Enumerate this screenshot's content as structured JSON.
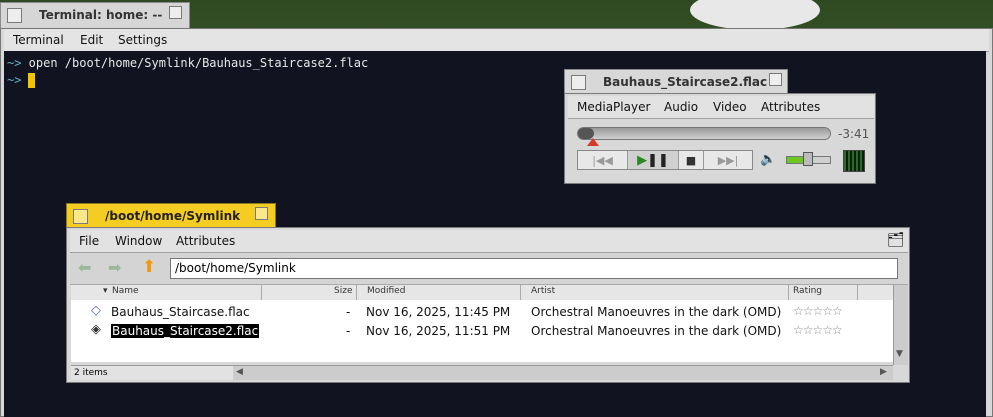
{
  "terminal": {
    "title": "Terminal: home: --",
    "menu": [
      "Terminal",
      "Edit",
      "Settings"
    ],
    "lines": [
      {
        "prompt": "~>",
        "text": " open /boot/home/Symlink/Bauhaus_Staircase2.flac"
      },
      {
        "prompt": "~>",
        "text": ""
      }
    ]
  },
  "mediaplayer": {
    "title": "Bauhaus_Staircase2.flac",
    "menu": [
      "MediaPlayer",
      "Audio",
      "Video",
      "Attributes"
    ],
    "time_remaining": "-3:41",
    "volume_level": 0.55
  },
  "tracker": {
    "title": "/boot/home/Symlink",
    "menu": [
      "File",
      "Window",
      "Attributes"
    ],
    "path": "/boot/home/Symlink",
    "columns": [
      "Name",
      "Size",
      "Modified",
      "Artist",
      "Rating"
    ],
    "rows": [
      {
        "name": "Bauhaus_Staircase.flac",
        "size": "-",
        "modified": "Nov 16, 2025, 11:45 PM",
        "artist": "Orchestral Manoeuvres in the dark (OMD)",
        "rating": "☆☆☆☆☆",
        "selected": false
      },
      {
        "name": "Bauhaus_Staircase2.flac",
        "size": "-",
        "modified": "Nov 16, 2025, 11:51 PM",
        "artist": "Orchestral Manoeuvres in the dark (OMD)",
        "rating": "☆☆☆☆☆",
        "selected": true
      }
    ],
    "status": "2 items"
  },
  "colors": {
    "tracker_tab": "#f5cc22",
    "terminal_bg": "#111420",
    "cursor": "#f5c400",
    "prompt": "#5fb3c8"
  }
}
